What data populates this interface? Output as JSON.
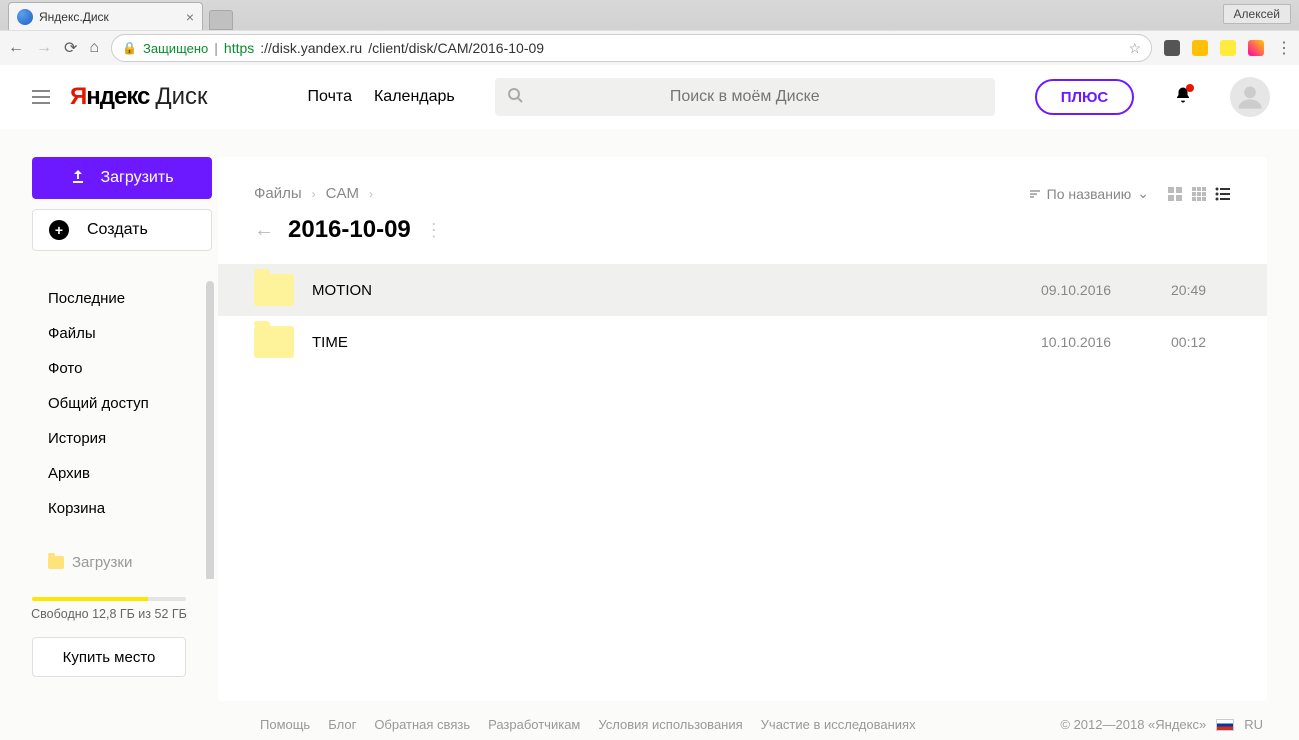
{
  "browser": {
    "tab_title": "Яндекс.Диск",
    "profile": "Алексей",
    "secure_label": "Защищено",
    "url_https": "https",
    "url_host": "://disk.yandex.ru",
    "url_path": "/client/disk/CAM/2016-10-09"
  },
  "header": {
    "logo_ya": "Я",
    "logo_ndex": "ндекс",
    "logo_disk": "Диск",
    "nav_mail": "Почта",
    "nav_cal": "Календарь",
    "search_placeholder": "Поиск в моём Диске",
    "plus_label": "ПЛЮС"
  },
  "sidebar": {
    "upload": "Загрузить",
    "create": "Создать",
    "items": [
      {
        "label": "Последние"
      },
      {
        "label": "Файлы"
      },
      {
        "label": "Фото"
      },
      {
        "label": "Общий доступ"
      },
      {
        "label": "История"
      },
      {
        "label": "Архив"
      },
      {
        "label": "Корзина"
      }
    ],
    "folders": [
      {
        "label": "Загрузки"
      }
    ],
    "storage_text": "Свободно 12,8 ГБ из 52 ГБ",
    "buy": "Купить место"
  },
  "main": {
    "breadcrumb": [
      {
        "label": "Файлы"
      },
      {
        "label": "CAM"
      }
    ],
    "sort_label": "По названию",
    "title": "2016-10-09",
    "rows": [
      {
        "name": "MOTION",
        "date": "09.10.2016",
        "time": "20:49",
        "selected": true
      },
      {
        "name": "TIME",
        "date": "10.10.2016",
        "time": "00:12",
        "selected": false
      }
    ]
  },
  "footer": {
    "links": [
      {
        "label": "Помощь"
      },
      {
        "label": "Блог"
      },
      {
        "label": "Обратная связь"
      },
      {
        "label": "Разработчикам"
      },
      {
        "label": "Условия использования"
      },
      {
        "label": "Участие в исследованиях"
      }
    ],
    "copyright": "© 2012—2018 «Яндекс»",
    "lang": "RU"
  }
}
